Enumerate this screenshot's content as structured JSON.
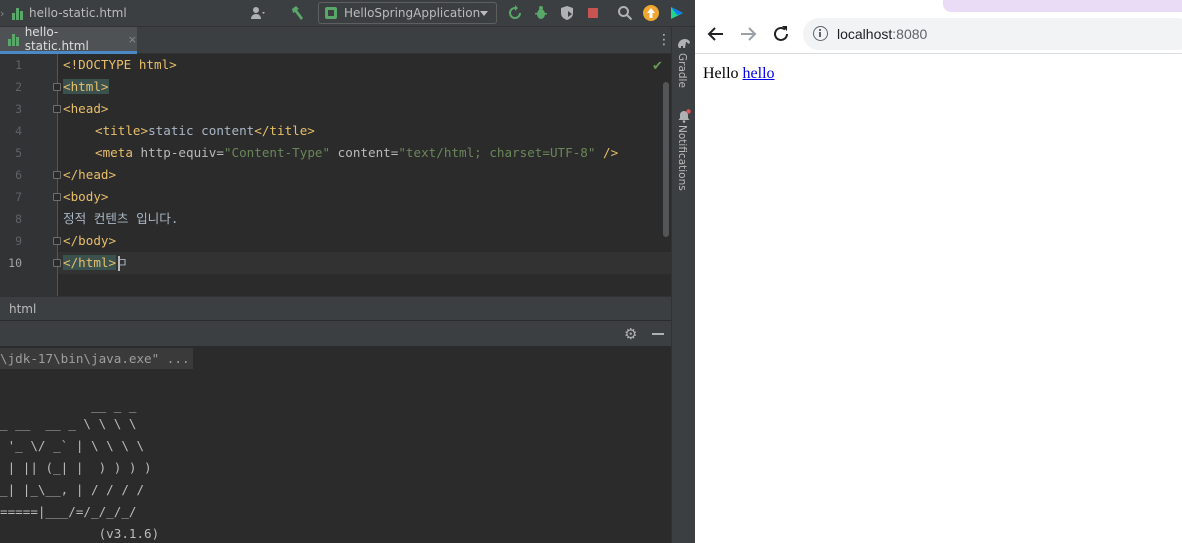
{
  "ide": {
    "titlebar_file": "hello-static.html",
    "run_config": "HelloSpringApplication",
    "tab_label": "hello-static.html",
    "tab_close": "×",
    "editor": {
      "line_numbers": [
        "1",
        "2",
        "3",
        "4",
        "5",
        "6",
        "7",
        "8",
        "9",
        "10"
      ],
      "lines": {
        "l1": "<!DOCTYPE html>",
        "l2_tag": "<html>",
        "l3_tag": "<head>",
        "l4_open": "<title>",
        "l4_text": "static content",
        "l4_close": "</title>",
        "l5_tag": "<meta",
        "l5_attr1": " http-equiv=",
        "l5_val1": "\"Content-Type\"",
        "l5_attr2": " content=",
        "l5_val2": "\"text/html; charset=UTF-8\"",
        "l5_end": " />",
        "l6_tag": "</head>",
        "l7_tag": "<body>",
        "l8_text": "정적 컨텐츠 입니다.",
        "l9_tag": "</body>",
        "l10_tag": "</html>",
        "l10_ime": "ㅁ"
      }
    },
    "breadcrumb": "html",
    "side_labels": {
      "gradle": "Gradle",
      "notifications": "Notifications"
    },
    "console": {
      "command": "\\jdk-17\\bin\\java.exe\" ...",
      "banner": [
        "            __ _ _",
        "_ __  __ _ \\ \\ \\ \\",
        " '_ \\/ _` | \\ \\ \\ \\",
        " | || (_| |  ) ) ) )",
        "_| |_\\__, | / / / /",
        "=====|___/=/_/_/_/",
        "             (v3.1.6)"
      ]
    },
    "colors": {
      "tag": "#e8bf6a",
      "string": "#6a8759",
      "text": "#a9b7c6",
      "tab_underline": "#4a88c7"
    }
  },
  "browser": {
    "url_host": "localhost",
    "url_port": ":8080",
    "page_text": "Hello",
    "page_link": "hello",
    "icons": [
      "back-arrow-icon",
      "forward-arrow-icon",
      "reload-icon",
      "info-icon"
    ]
  }
}
